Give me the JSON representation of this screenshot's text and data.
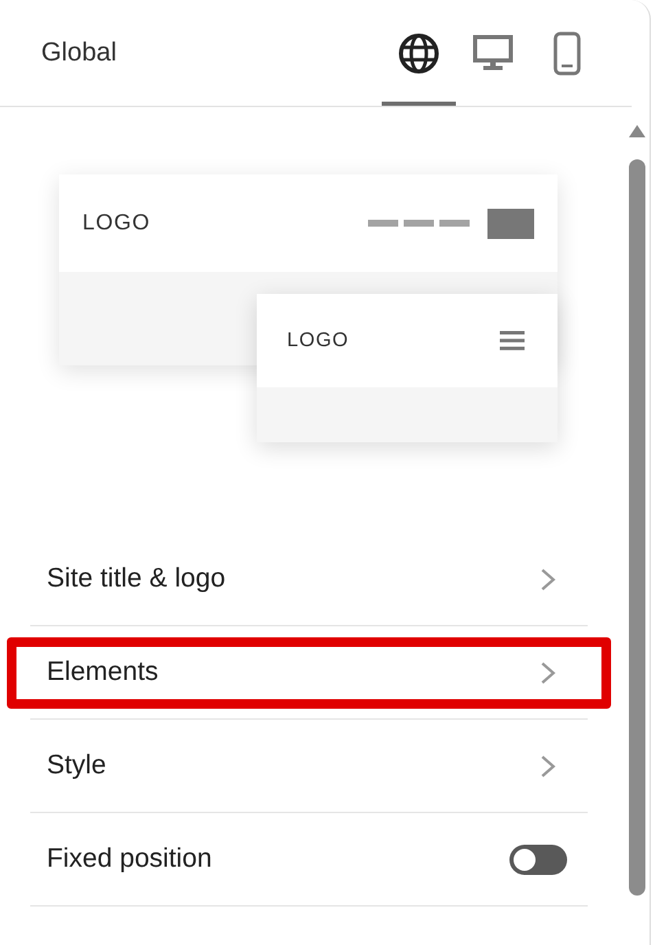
{
  "header": {
    "title": "Global"
  },
  "tabs": [
    {
      "kind": "globe",
      "selected": true
    },
    {
      "kind": "desktop",
      "selected": false
    },
    {
      "kind": "mobile",
      "selected": false
    }
  ],
  "preview": {
    "desktop_logo": "LOGO",
    "mobile_logo": "LOGO"
  },
  "menu": [
    {
      "kind": "link",
      "label": "Site title & logo",
      "highlighted": false
    },
    {
      "kind": "link",
      "label": "Elements",
      "highlighted": true
    },
    {
      "kind": "link",
      "label": "Style",
      "highlighted": false
    },
    {
      "kind": "toggle",
      "label": "Fixed position",
      "highlighted": false,
      "on": false
    }
  ]
}
